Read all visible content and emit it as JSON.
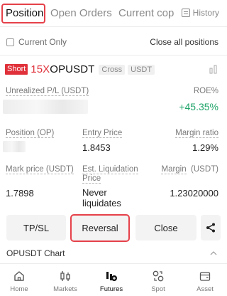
{
  "tabs": [
    {
      "label": "Position"
    },
    {
      "label": "Open Orders"
    },
    {
      "label": "Current cop"
    }
  ],
  "history_label": "History",
  "filter": {
    "current_only_label": "Current Only",
    "close_all_label": "Close all positions"
  },
  "position": {
    "side_badge": "Short",
    "leverage_prefix": "15X",
    "symbol": "OPUSDT",
    "margin_mode": "Cross",
    "settle_coin": "USDT",
    "unrealized_pl_label": "Unrealized P/L (USDT)",
    "roe_label": "ROE%",
    "roe_value": "+45.35%",
    "position_label": "Position (OP)",
    "entry_price_label": "Entry Price",
    "entry_price_value": "1.8453",
    "margin_ratio_label": "Margin ratio",
    "margin_ratio_value": "1.29%",
    "mark_price_label": "Mark price (USDT)",
    "mark_price_value": "1.7898",
    "est_liq_label_1": "Est. Liquidation",
    "est_liq_label_2": "Price",
    "est_liq_value_1": "Never",
    "est_liq_value_2": "liquidates",
    "margin_label": "Margin",
    "margin_unit": "(USDT)",
    "margin_value": "1.23020000"
  },
  "actions": {
    "tpsl": "TP/SL",
    "reversal": "Reversal",
    "close": "Close"
  },
  "chart_title": "OPUSDT Chart",
  "bottom_nav": [
    {
      "label": "Home"
    },
    {
      "label": "Markets"
    },
    {
      "label": "Futures"
    },
    {
      "label": "Spot"
    },
    {
      "label": "Asset"
    }
  ],
  "colors": {
    "accent_red": "#e0313a",
    "profit_green": "#20a46a",
    "highlight_box": "#e5414a"
  }
}
